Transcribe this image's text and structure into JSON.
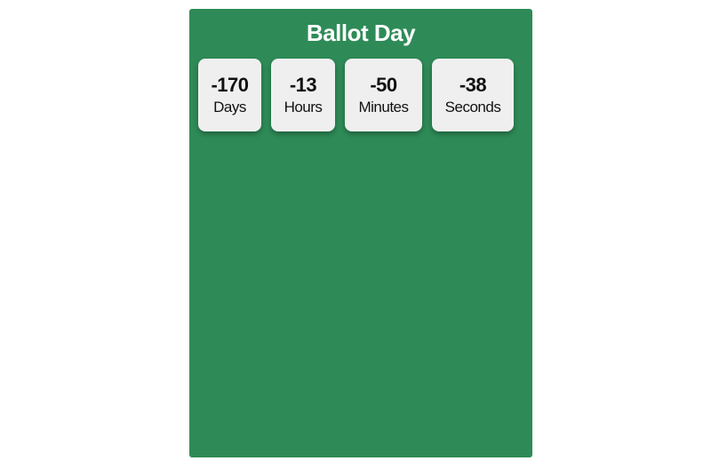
{
  "title": "Ballot Day",
  "background_color": "#2e8b57",
  "countdown": [
    {
      "value": "-170",
      "label": "Days"
    },
    {
      "value": "-13",
      "label": "Hours"
    },
    {
      "value": "-50",
      "label": "Minutes"
    },
    {
      "value": "-38",
      "label": "Seconds"
    }
  ]
}
